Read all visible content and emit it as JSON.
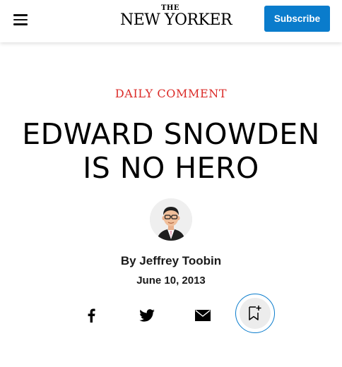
{
  "header": {
    "logo_small": "THE",
    "logo_main": "NEW YORKER",
    "subscribe_label": "Subscribe",
    "menu_icon": "hamburger-menu-icon"
  },
  "article": {
    "rubric": "DAILY COMMENT",
    "headline_line1": "EDWARD SNOWDEN",
    "headline_line2": "IS NO HERO",
    "byline_prefix": "By",
    "author": "Jeffrey Toobin",
    "date": "June 10, 2013"
  },
  "share": {
    "icons": [
      "facebook-icon",
      "twitter-icon",
      "email-icon",
      "bookmark-add-icon"
    ]
  },
  "colors": {
    "accent_red": "#db2b28",
    "subscribe_blue": "#0a7ccc"
  }
}
